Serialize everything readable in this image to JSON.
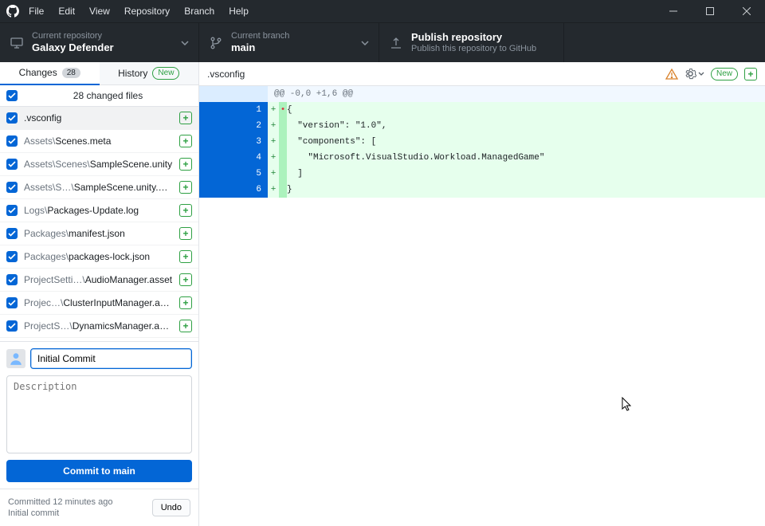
{
  "menu": {
    "file": "File",
    "edit": "Edit",
    "view": "View",
    "repository": "Repository",
    "branch": "Branch",
    "help": "Help"
  },
  "toolbar": {
    "repo_label": "Current repository",
    "repo_name": "Galaxy Defender",
    "branch_label": "Current branch",
    "branch_name": "main",
    "publish_title": "Publish repository",
    "publish_sub": "Publish this repository to GitHub"
  },
  "tabs": {
    "changes": "Changes",
    "changes_count": "28",
    "history": "History",
    "history_badge": "New"
  },
  "filelist": {
    "summary": "28 changed files",
    "items": [
      {
        "pre": "",
        "name": ".vsconfig",
        "selected": true
      },
      {
        "pre": "Assets\\",
        "name": "Scenes.meta"
      },
      {
        "pre": "Assets\\Scenes\\",
        "name": "SampleScene.unity"
      },
      {
        "pre": "Assets\\S…\\",
        "name": "SampleScene.unity.meta"
      },
      {
        "pre": "Logs\\",
        "name": "Packages-Update.log"
      },
      {
        "pre": "Packages\\",
        "name": "manifest.json"
      },
      {
        "pre": "Packages\\",
        "name": "packages-lock.json"
      },
      {
        "pre": "ProjectSetti…\\",
        "name": "AudioManager.asset"
      },
      {
        "pre": "Projec…\\",
        "name": "ClusterInputManager.asset"
      },
      {
        "pre": "ProjectS…\\",
        "name": "DynamicsManager.asset"
      }
    ]
  },
  "commit": {
    "summary_value": "Initial Commit",
    "desc_placeholder": "Description",
    "button_prefix": "Commit to ",
    "button_branch": "main"
  },
  "recent": {
    "line1": "Committed 12 minutes ago",
    "line2": "Initial commit",
    "undo": "Undo"
  },
  "diff": {
    "filename": ".vsconfig",
    "badge": "New",
    "hunk": "@@ -0,0 +1,6 @@",
    "lines": [
      {
        "n": "1",
        "first": "•",
        "t": "{"
      },
      {
        "n": "2",
        "first": "",
        "t": "  \"version\": \"1.0\","
      },
      {
        "n": "3",
        "first": "",
        "t": "  \"components\": ["
      },
      {
        "n": "4",
        "first": "",
        "t": "    \"Microsoft.VisualStudio.Workload.ManagedGame\""
      },
      {
        "n": "5",
        "first": "",
        "t": "  ]"
      },
      {
        "n": "6",
        "first": "",
        "t": "}"
      }
    ]
  }
}
